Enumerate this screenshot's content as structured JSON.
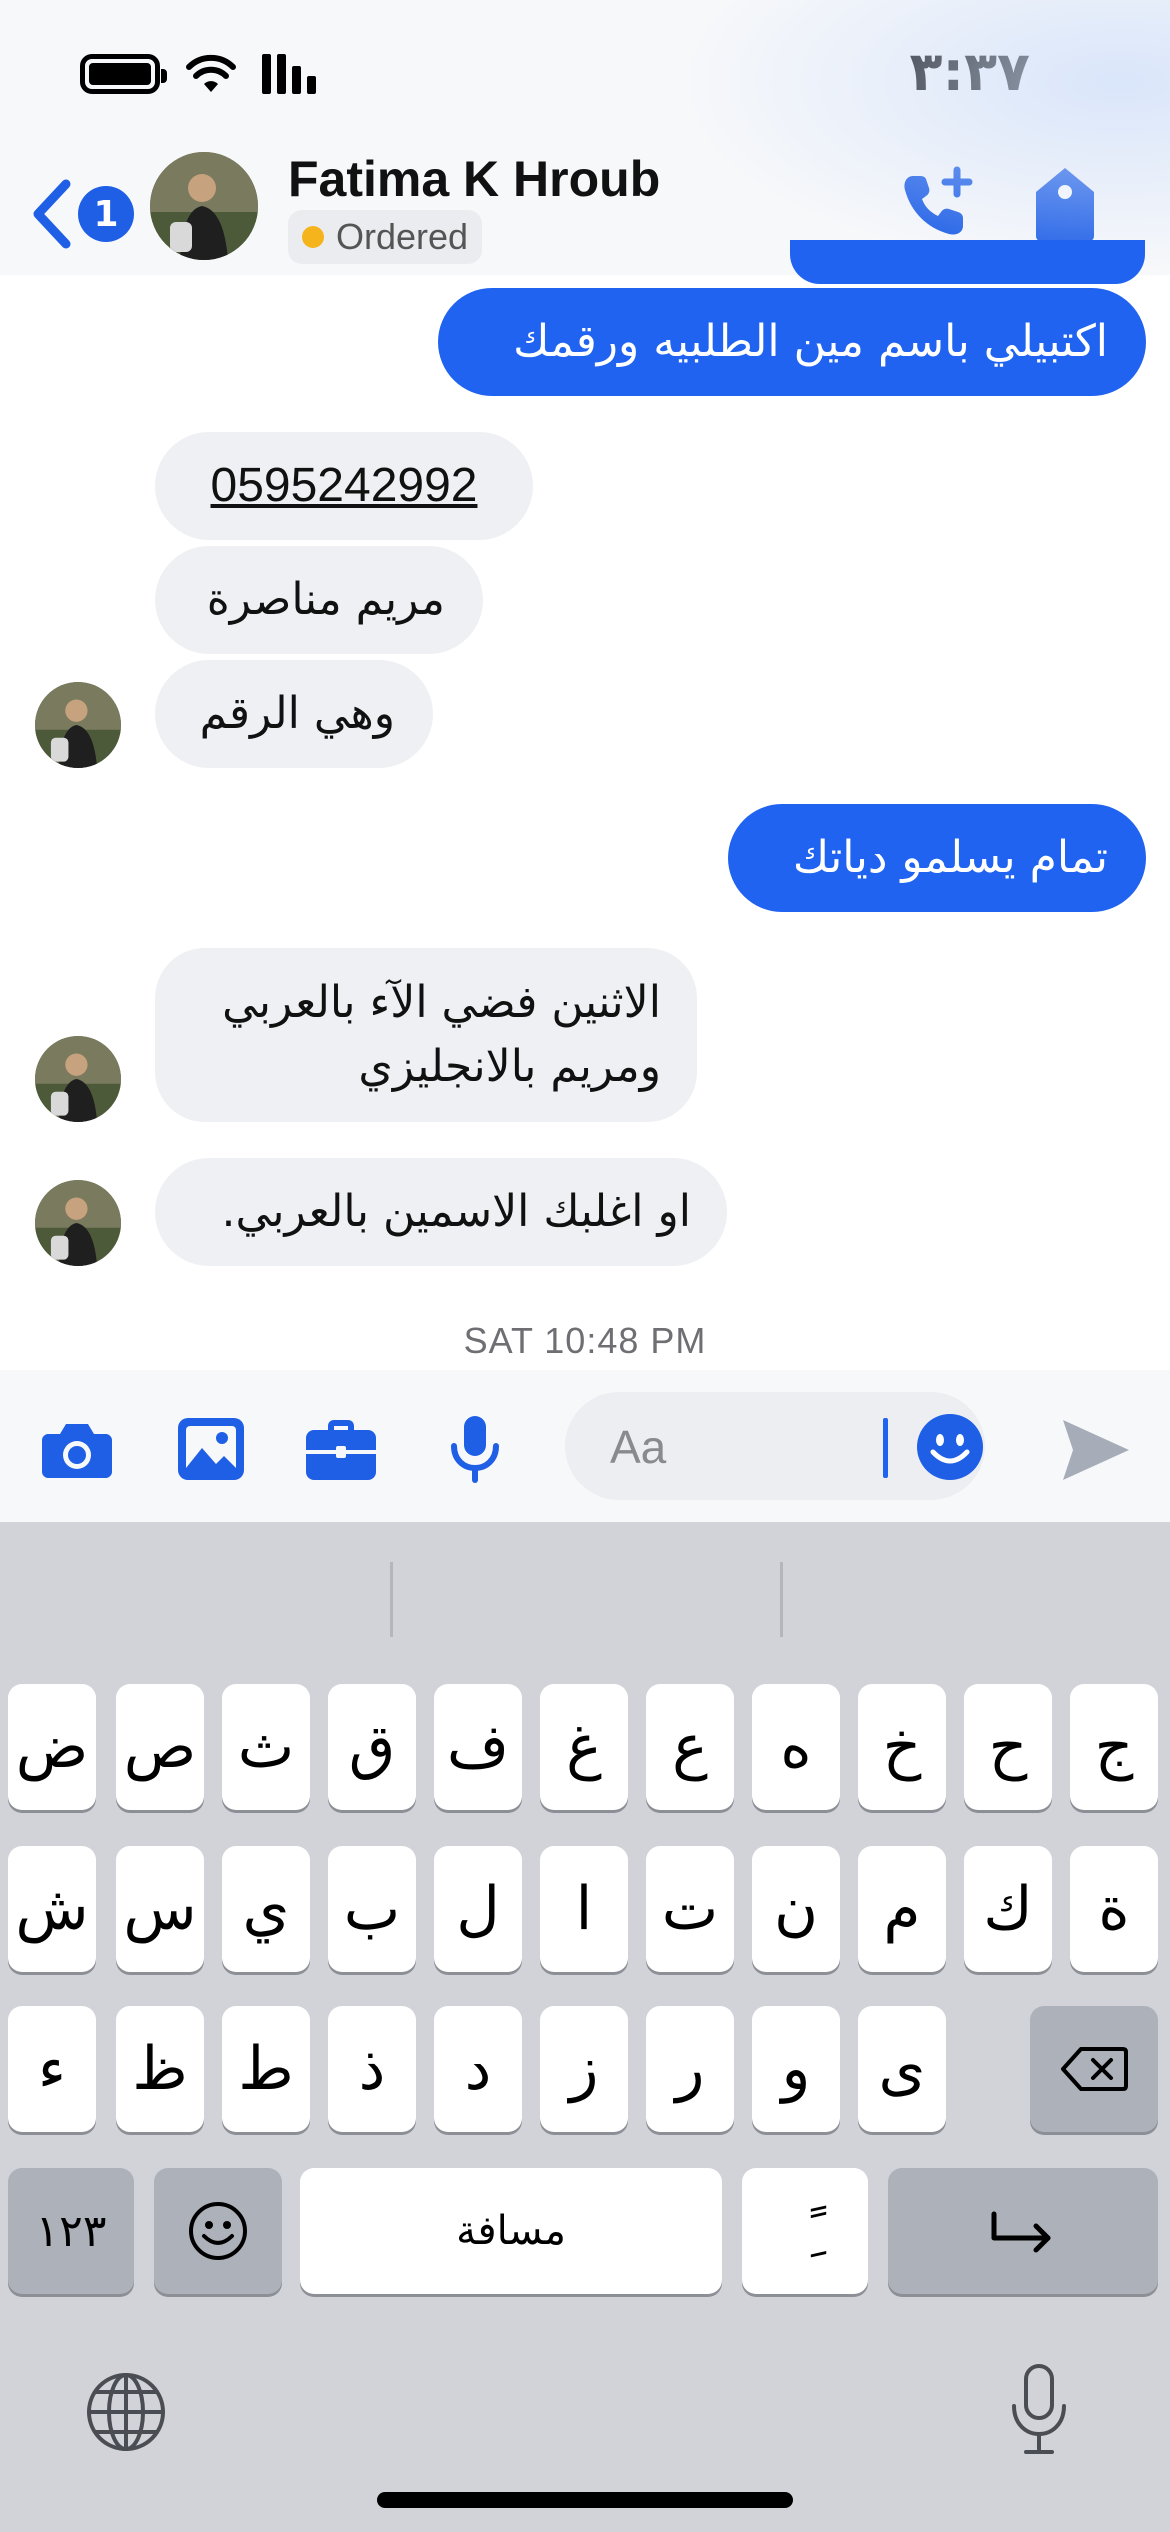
{
  "status": {
    "time": "٣:٣٧"
  },
  "header": {
    "contact_name": "Fatima K Hroub",
    "order_status": "Ordered",
    "back_badge": "1"
  },
  "messages": [
    {
      "side": "out",
      "text": "اكتبيلي باسم مين الطلبيه ورقمك"
    },
    {
      "side": "in",
      "text": "0595242992"
    },
    {
      "side": "in",
      "text": "مريم مناصرة"
    },
    {
      "side": "in",
      "text": "وهي الرقم"
    },
    {
      "side": "out",
      "text": "تمام يسلمو دياتك"
    },
    {
      "side": "in",
      "text_line1": "الاثنين فضي  الآء بالعربي",
      "text_line2": "ومريم بالانجليزي"
    },
    {
      "side": "in",
      "text": "او اغلبك الاسمين بالعربي."
    }
  ],
  "timestamp": "SAT 10:48 PM",
  "composer": {
    "placeholder": "Aa"
  },
  "keyboard": {
    "row1": [
      "ض",
      "ص",
      "ث",
      "ق",
      "ف",
      "غ",
      "ع",
      "ه",
      "خ",
      "ح",
      "ج"
    ],
    "row2": [
      "ش",
      "س",
      "ي",
      "ب",
      "ل",
      "ا",
      "ت",
      "ن",
      "م",
      "ك",
      "ة"
    ],
    "row3": [
      "ء",
      "ظ",
      "ط",
      "ذ",
      "د",
      "ز",
      "ر",
      "و",
      "ى"
    ],
    "numbers_label": "١٢٣",
    "space_label": "مسافة",
    "diacritic_label": "ًِ"
  },
  "colors": {
    "outgoing_bubble": "#1f63f0",
    "incoming_bubble": "#eff0f3",
    "accent": "#1f5fe6",
    "order_dot": "#f5b41b"
  }
}
